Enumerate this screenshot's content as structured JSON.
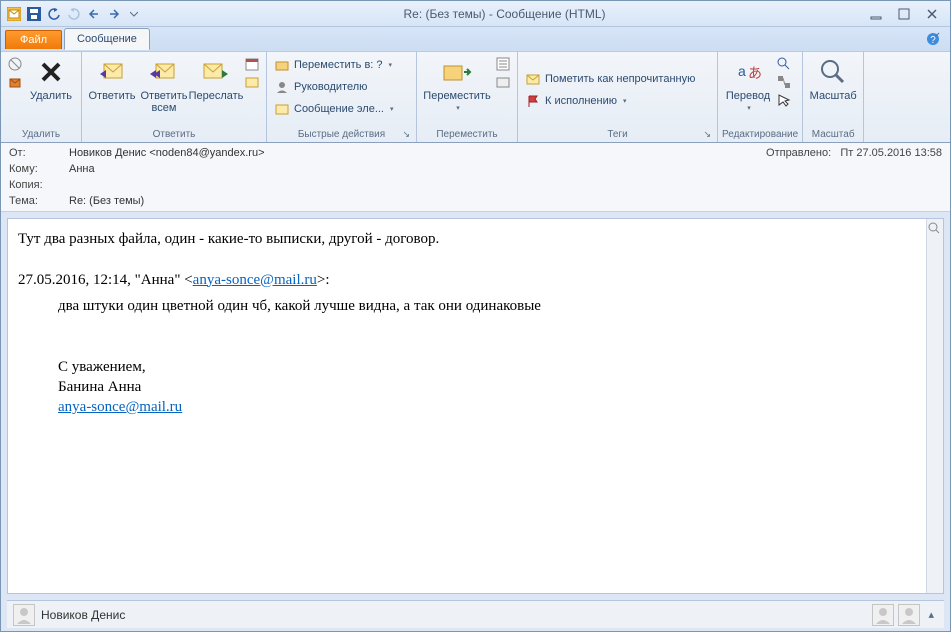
{
  "window": {
    "title": "Re: (Без темы)  -  Сообщение (HTML)"
  },
  "tabs": {
    "file": "Файл",
    "message": "Сообщение"
  },
  "ribbon": {
    "delete_group": "Удалить",
    "delete": "Удалить",
    "respond_group": "Ответить",
    "reply": "Ответить",
    "reply_all": "Ответить всем",
    "forward": "Переслать",
    "quick_steps_group": "Быстрые действия",
    "move_to": "Переместить в: ?",
    "to_manager": "Руководителю",
    "team_email": "Сообщение эле...",
    "move_group": "Переместить",
    "move": "Переместить",
    "tags_group": "Теги",
    "mark_unread": "Пометить как непрочитанную",
    "follow_up": "К исполнению",
    "editing_group": "Редактирование",
    "translate": "Перевод",
    "zoom_group": "Масштаб",
    "zoom": "Масштаб"
  },
  "headers": {
    "from_label": "От:",
    "from_value": "Новиков Денис <noden84@yandex.ru>",
    "sent_label": "Отправлено:",
    "sent_value": "Пт 27.05.2016 13:58",
    "to_label": "Кому:",
    "to_value": "Анна",
    "cc_label": "Копия:",
    "cc_value": "",
    "subject_label": "Тема:",
    "subject_value": "Re: (Без темы)"
  },
  "body": {
    "line1": "Тут два разных файла, один - какие-то выписки, другой - договор.",
    "quote_header_prefix": "27.05.2016, 12:14, \"Анна\" <",
    "quote_header_email": "anya-sonce@mail.ru",
    "quote_header_suffix": ">:",
    "quoted_line": "два штуки один цветной один чб, какой лучше видна, а так они одинаковые",
    "sig1": "С уважением,",
    "sig2": "Банина Анна",
    "sig_email": "anya-sonce@mail.ru"
  },
  "people": {
    "name": "Новиков Денис"
  }
}
